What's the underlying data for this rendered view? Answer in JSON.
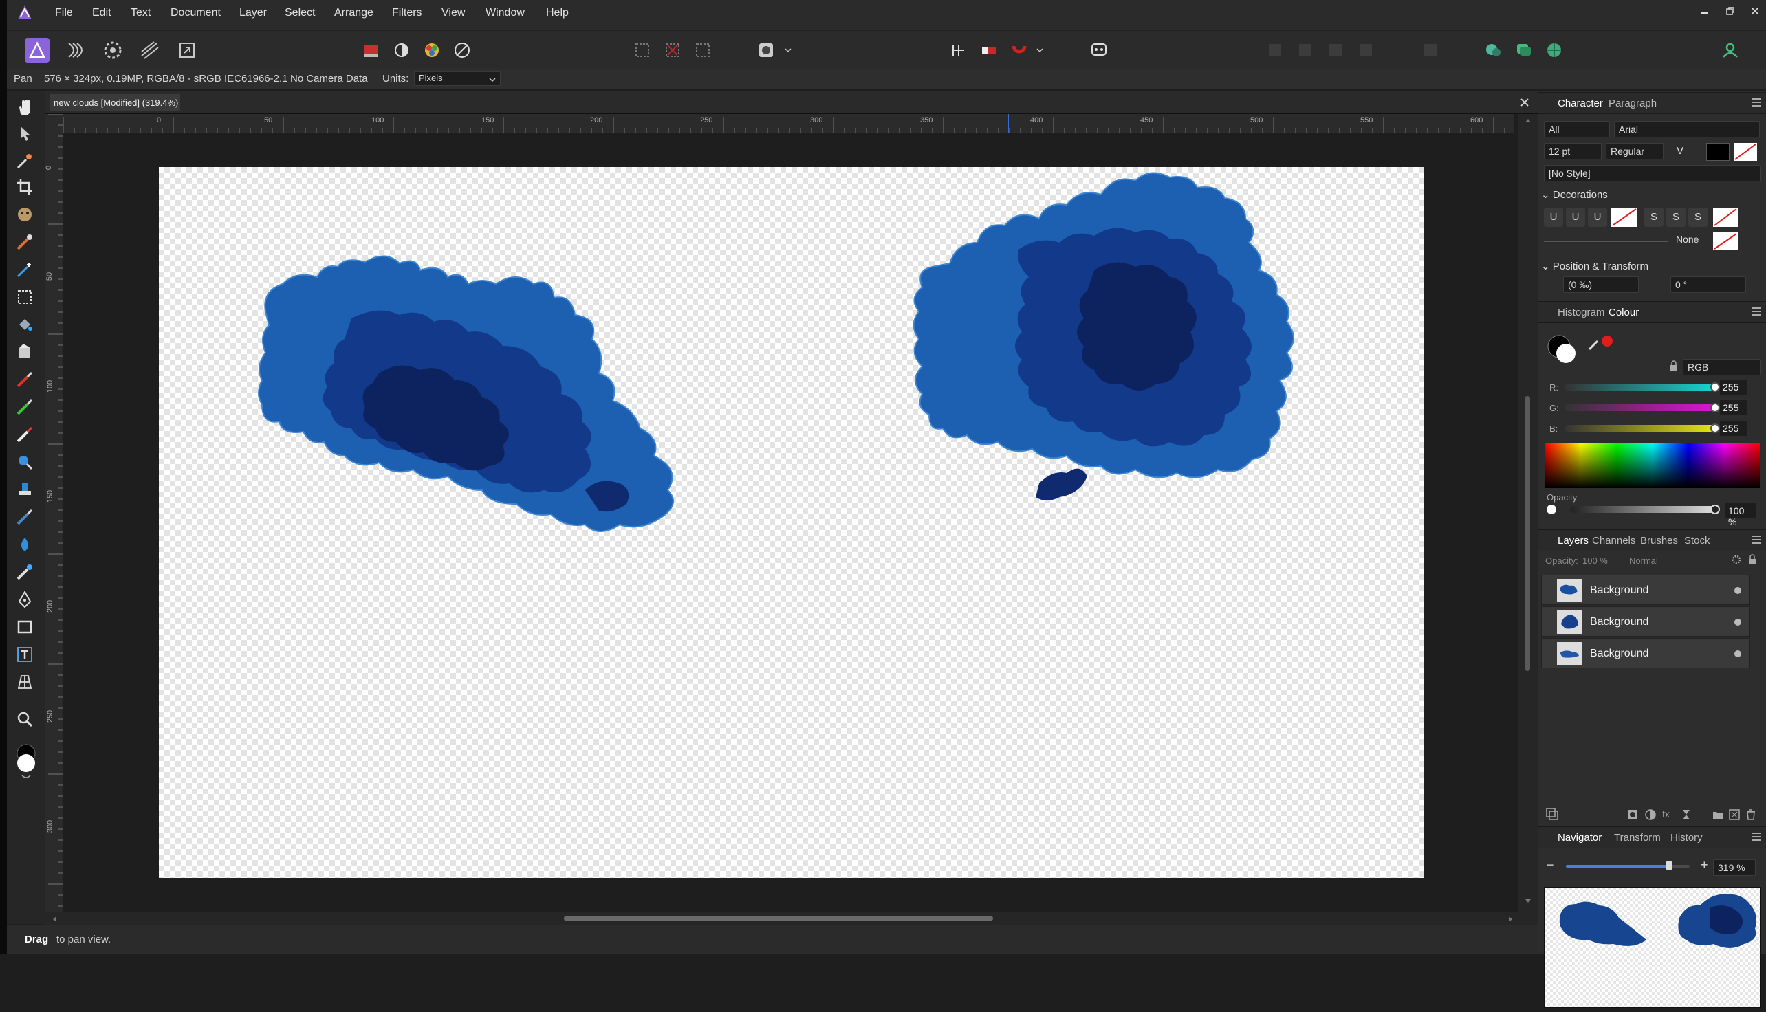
{
  "app": {
    "logo_icon": "affinity-photo-logo-icon"
  },
  "menu": [
    "File",
    "Edit",
    "Text",
    "Document",
    "Layer",
    "Select",
    "Arrange",
    "Filters",
    "View",
    "Window",
    "Help"
  ],
  "context": {
    "tool": "Pan",
    "doc_info": "576 × 324px, 0.19MP, RGBA/8 - sRGB IEC61966-2.1",
    "camera": "No Camera Data",
    "units_label": "Units:",
    "units_value": "Pixels"
  },
  "document": {
    "tab_title": "new clouds [Modified] (319.4%)",
    "ruler_unit": "px",
    "h_ticks": [
      "0",
      "50",
      "100",
      "150",
      "200",
      "250",
      "300",
      "350",
      "400",
      "450",
      "500",
      "550",
      "600"
    ],
    "v_ticks": [
      "0",
      "50",
      "100",
      "150",
      "200",
      "250",
      "300"
    ]
  },
  "status": {
    "bold": "Drag",
    "rest": "to pan view."
  },
  "character": {
    "tab1": "Character",
    "tab2": "Paragraph",
    "scope": "All",
    "font": "Arial",
    "size": "12 pt",
    "weight": "Regular",
    "style": "[No Style]",
    "decorations_title": "Decorations",
    "deco_none": "None",
    "position_title": "Position & Transform",
    "tracking": "(0 ‰)",
    "rotation": "0 °"
  },
  "colour": {
    "tab1": "Histogram",
    "tab2": "Colour",
    "model": "RGB",
    "r_label": "R:",
    "g_label": "G:",
    "b_label": "B:",
    "r": "255",
    "g": "255",
    "b": "255",
    "opacity_label": "Opacity",
    "opacity": "100 %",
    "colors": {
      "r_slider": "#19d4d4",
      "g_slider": "#e213d2",
      "b_slider": "#e6e60f"
    }
  },
  "layers": {
    "tabs": [
      "Layers",
      "Channels",
      "Brushes",
      "Stock"
    ],
    "opacity_label": "Opacity:",
    "opacity": "100 %",
    "blend": "Normal",
    "items": [
      {
        "name": "Background"
      },
      {
        "name": "Background"
      },
      {
        "name": "Background"
      }
    ]
  },
  "navigator": {
    "tabs": [
      "Navigator",
      "Transform",
      "History"
    ],
    "zoom": "319 %",
    "minus": "−",
    "plus": "+"
  },
  "colors": {
    "cloud_light": "#1d5fb0",
    "cloud_mid": "#12398a",
    "cloud_dark": "#0d2360",
    "accent": "#8a62d9"
  }
}
